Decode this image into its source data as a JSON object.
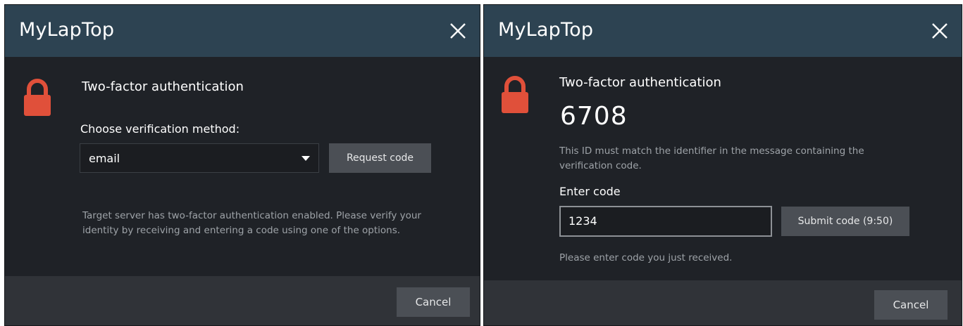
{
  "colors": {
    "titlebar": "#2d4352",
    "body": "#1f2227",
    "footer": "#303338",
    "lock": "#e0503a",
    "button": "#4b4f55",
    "muted_text": "#9ea3a8"
  },
  "left_dialog": {
    "title": "MyLapTop",
    "close_icon": "close-icon",
    "lock_icon": "lock-icon",
    "heading": "Two-factor authentication",
    "method_label": "Choose verification method:",
    "method_select": {
      "value": "email"
    },
    "request_button": "Request code",
    "info_line1": "Target server has two-factor authentication enabled. Please verify your",
    "info_line2": "identity by receiving and entering a code using one of the options.",
    "cancel_button": "Cancel"
  },
  "right_dialog": {
    "title": "MyLapTop",
    "close_icon": "close-icon",
    "lock_icon": "lock-icon",
    "heading": "Two-factor authentication",
    "identifier": "6708",
    "identifier_note_line1": "This ID must match the identifier in the message containing the",
    "identifier_note_line2": "verification code.",
    "code_label": "Enter code",
    "code_input": {
      "value": "1234"
    },
    "submit_button": "Submit code (9:50)",
    "hint": "Please enter code you just received.",
    "cancel_button": "Cancel"
  }
}
